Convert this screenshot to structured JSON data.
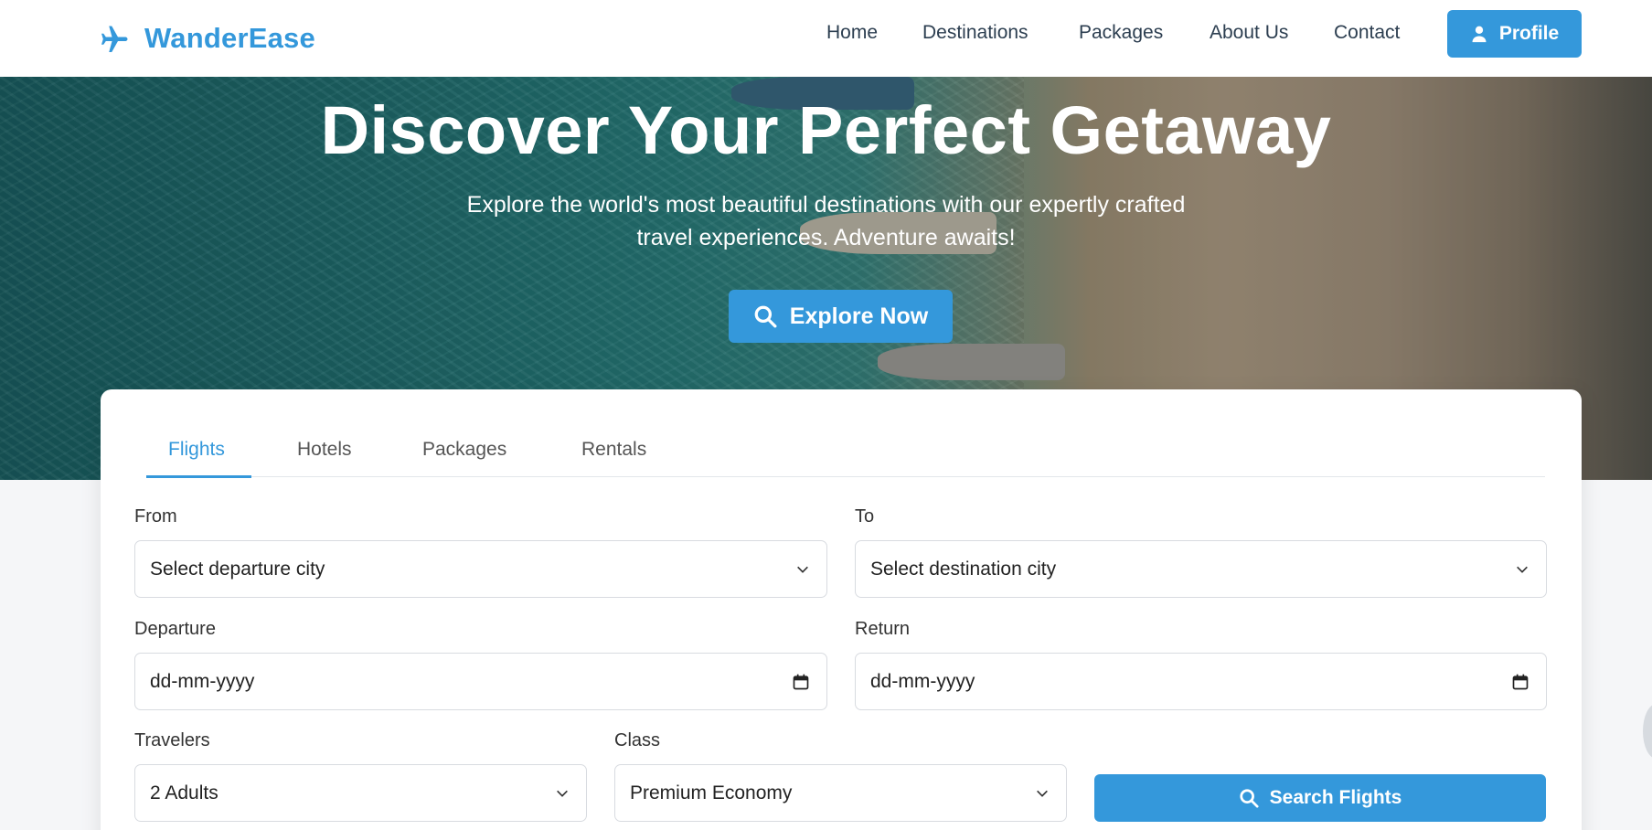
{
  "brand": {
    "name": "WanderEase",
    "icon": "airplane-icon",
    "color": "#3498db"
  },
  "nav": {
    "links": [
      "Home",
      "Destinations",
      "Packages",
      "About Us",
      "Contact"
    ],
    "profile_label": "Profile",
    "profile_icon": "user-icon"
  },
  "hero": {
    "title": "Discover Your Perfect Getaway",
    "subtitle": "Explore the world's most beautiful destinations with our expertly crafted travel experiences. Adventure awaits!",
    "cta_label": "Explore Now",
    "cta_icon": "search-icon"
  },
  "search": {
    "tabs": [
      "Flights",
      "Hotels",
      "Packages",
      "Rentals"
    ],
    "active_tab": "Flights",
    "from": {
      "label": "From",
      "value": "Select departure city"
    },
    "to": {
      "label": "To",
      "value": "Select destination city"
    },
    "departure": {
      "label": "Departure",
      "value": "dd-mm-yyyy"
    },
    "return": {
      "label": "Return",
      "value": "dd-mm-yyyy"
    },
    "travelers": {
      "label": "Travelers",
      "value": "2 Adults"
    },
    "class": {
      "label": "Class",
      "value": "Premium Economy"
    },
    "submit_label": "Search Flights"
  },
  "colors": {
    "accent": "#3498db",
    "nav_text": "#2c3e50"
  }
}
